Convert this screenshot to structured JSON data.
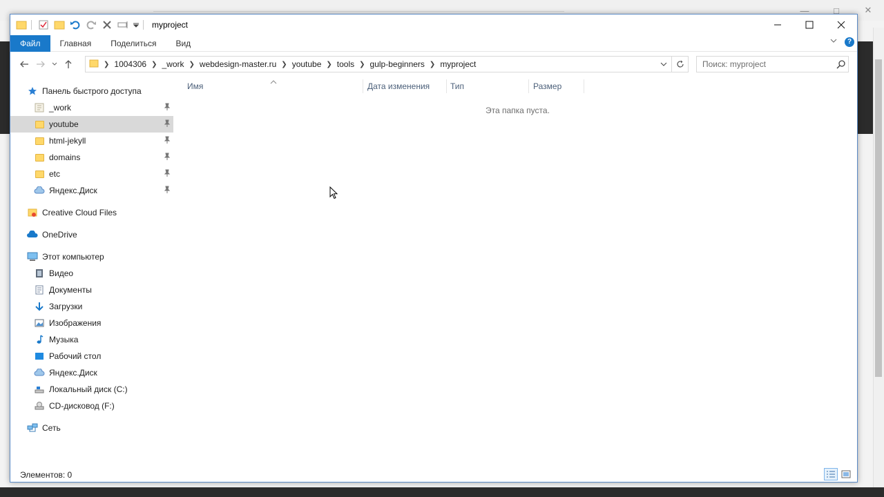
{
  "window": {
    "title": "myproject",
    "minimize_glyph": "—",
    "maximize_glyph": "□",
    "close_glyph": "✕"
  },
  "ribbon": {
    "tabs": [
      "Файл",
      "Главная",
      "Поделиться",
      "Вид"
    ],
    "help": "?"
  },
  "address": {
    "crumbs": [
      "1004306",
      "_work",
      "webdesign-master.ru",
      "youtube",
      "tools",
      "gulp-beginners",
      "myproject"
    ]
  },
  "search": {
    "placeholder": "Поиск: myproject"
  },
  "sidebar": {
    "quick_access": "Панель быстрого доступа",
    "quick_items": [
      "_work",
      "youtube",
      "html-jekyll",
      "domains",
      "etc",
      "Яндекс.Диск"
    ],
    "creative_cloud": "Creative Cloud Files",
    "onedrive": "OneDrive",
    "this_pc": "Этот компьютер",
    "pc_items": [
      "Видео",
      "Документы",
      "Загрузки",
      "Изображения",
      "Музыка",
      "Рабочий стол",
      "Яндекс.Диск",
      "Локальный диск (C:)",
      "CD-дисковод (F:)"
    ],
    "network": "Сеть"
  },
  "columns": {
    "name": "Имя",
    "date": "Дата изменения",
    "type": "Тип",
    "size": "Размер"
  },
  "content": {
    "empty_message": "Эта папка пуста."
  },
  "status": {
    "items_count": "Элементов: 0"
  },
  "colors": {
    "accent": "#1979ca",
    "selected": "#d9d9d9",
    "folder": "#ffd86a"
  }
}
